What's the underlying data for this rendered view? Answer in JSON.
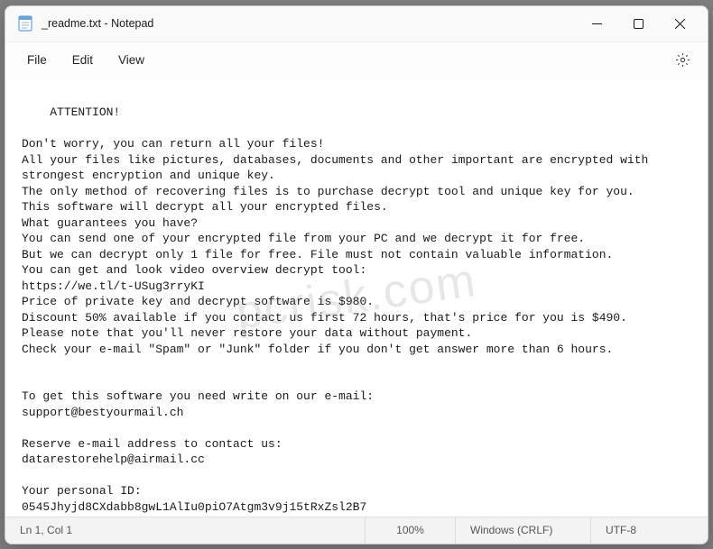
{
  "window": {
    "title": "_readme.txt - Notepad"
  },
  "menu": {
    "file": "File",
    "edit": "Edit",
    "view": "View"
  },
  "document": {
    "content": "ATTENTION!\n\nDon't worry, you can return all your files!\nAll your files like pictures, databases, documents and other important are encrypted with strongest encryption and unique key.\nThe only method of recovering files is to purchase decrypt tool and unique key for you.\nThis software will decrypt all your encrypted files.\nWhat guarantees you have?\nYou can send one of your encrypted file from your PC and we decrypt it for free.\nBut we can decrypt only 1 file for free. File must not contain valuable information.\nYou can get and look video overview decrypt tool:\nhttps://we.tl/t-USug3rryKI\nPrice of private key and decrypt software is $980.\nDiscount 50% available if you contact us first 72 hours, that's price for you is $490.\nPlease note that you'll never restore your data without payment.\nCheck your e-mail \"Spam\" or \"Junk\" folder if you don't get answer more than 6 hours.\n\n\nTo get this software you need write on our e-mail:\nsupport@bestyourmail.ch\n\nReserve e-mail address to contact us:\ndatarestorehelp@airmail.cc\n\nYour personal ID:\n0545Jhyjd8CXdabb8gwL1AlIu0piO7Atgm3v9j15tRxZsl2B7"
  },
  "statusbar": {
    "position": "Ln 1, Col 1",
    "zoom": "100%",
    "line_ending": "Windows (CRLF)",
    "encoding": "UTF-8"
  },
  "watermark": "pcrisk.com"
}
